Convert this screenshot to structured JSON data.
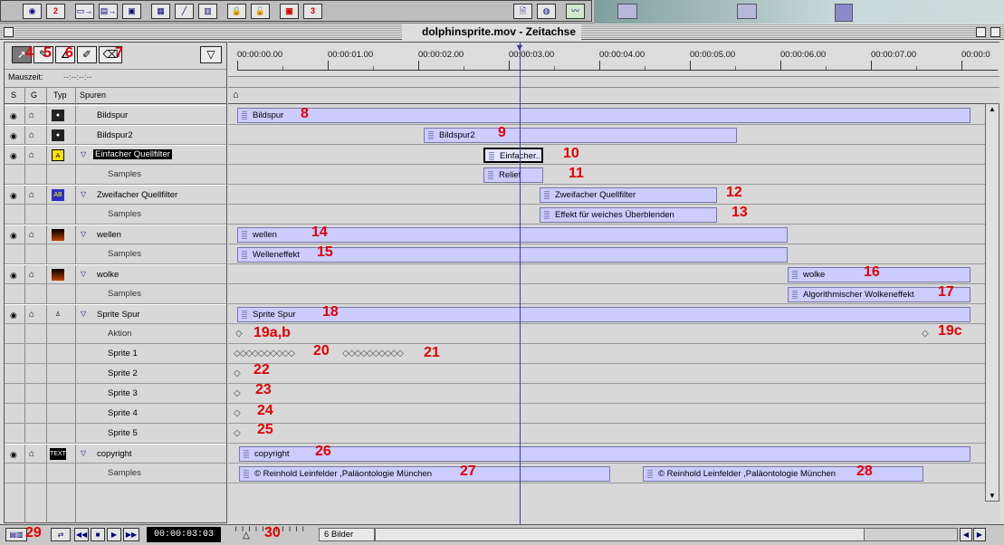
{
  "window": {
    "title": "dolphinsprite.mov - Zeitachse"
  },
  "toolbar": {
    "markers": [
      "2",
      "3"
    ]
  },
  "tools": {
    "items": [
      "4",
      "5",
      "6",
      "7"
    ]
  },
  "mauszeit": {
    "label": "Mauszeit:",
    "value": "--:--:--:--"
  },
  "columns": {
    "s": "S",
    "g": "G",
    "typ": "Typ",
    "spuren": "Spuren"
  },
  "ruler": {
    "ticks": [
      "00:00:00.00",
      "00:00:01.00",
      "00:00:02.00",
      "00:00:03.00",
      "00:00:04.00",
      "00:00:05.00",
      "00:00:06.00",
      "00:00:07.00",
      "00:00:0"
    ]
  },
  "tracks": [
    {
      "name": "Bildspur"
    },
    {
      "name": "Bildspur2"
    },
    {
      "name": "Einfacher Quellfilter"
    },
    {
      "name": "Samples"
    },
    {
      "name": "Zweifacher Quellfilter"
    },
    {
      "name": "Samples"
    },
    {
      "name": "wellen"
    },
    {
      "name": "Samples"
    },
    {
      "name": "wolke"
    },
    {
      "name": "Samples"
    },
    {
      "name": "Sprite Spur"
    },
    {
      "name": "Aktion"
    },
    {
      "name": "Sprite 1"
    },
    {
      "name": "Sprite 2"
    },
    {
      "name": "Sprite 3"
    },
    {
      "name": "Sprite 4"
    },
    {
      "name": "Sprite 5"
    },
    {
      "name": "copyright"
    },
    {
      "name": "Samples"
    }
  ],
  "type_icons": {
    "filter1": "A",
    "text": "TEXT"
  },
  "clips": {
    "bildspur": "Bildspur",
    "bildspur2": "Bildspur2",
    "einfacher": "Einfacher..",
    "relief": "Relief",
    "zweifacher": "Zweifacher Quellfilter",
    "weich": "Effekt für weiches Überblenden",
    "wellen": "wellen",
    "welleneffekt": "Welleneffekt",
    "wolke": "wolke",
    "wolkeneffekt": "Algorithmischer Wolkeneffekt",
    "sprite": "Sprite Spur",
    "copyright": "copyright",
    "copy1": "© Reinhold Leinfelder ,Paläontologie München",
    "copy2": "© Reinhold Leinfelder ,Paläontologie München"
  },
  "callouts": {
    "n8": "8",
    "n9": "9",
    "n10": "10",
    "n11": "11",
    "n12": "12",
    "n13": "13",
    "n14": "14",
    "n15": "15",
    "n16": "16",
    "n17": "17",
    "n18": "18",
    "n19ab": "19a,b",
    "n19c": "19c",
    "n20": "20",
    "n21": "21",
    "n22": "22",
    "n23": "23",
    "n24": "24",
    "n25": "25",
    "n26": "26",
    "n27": "27",
    "n28": "28",
    "n29": "29",
    "n30": "30"
  },
  "bottom": {
    "timecode": "00:00:03:03",
    "frames": "6 Bilder"
  },
  "colors": {
    "clip": "#ccccff",
    "playhead": "#3a3aa8",
    "callout": "#e00000"
  }
}
